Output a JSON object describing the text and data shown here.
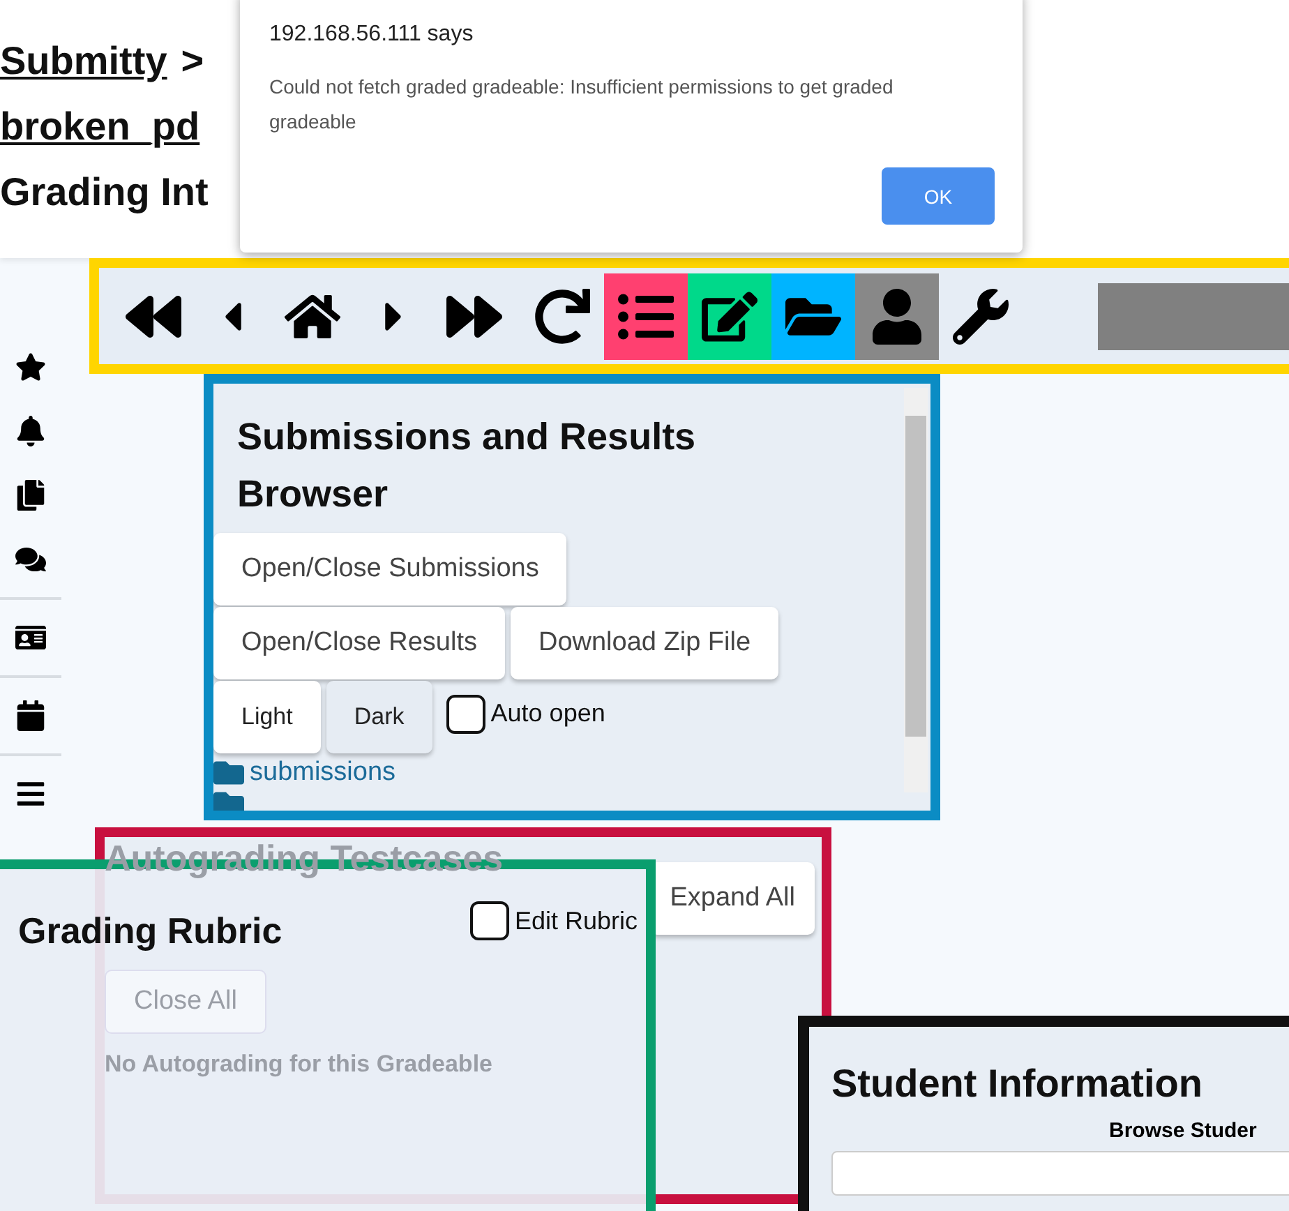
{
  "header": {
    "breadcrumb": [
      {
        "kind": "link",
        "text": "Submitty"
      },
      {
        "kind": "separator",
        "text": ">"
      },
      {
        "kind": "link",
        "text": "broken_pd"
      }
    ],
    "page_title": "Grading Int"
  },
  "dialog": {
    "origin": "192.168.56.111 says",
    "message": "Could not fetch graded gradeable: Insufficient permissions to get graded gradeable",
    "button": "OK"
  },
  "toolbar": {
    "buttons": [
      {
        "kind": "first"
      },
      {
        "kind": "prev"
      },
      {
        "kind": "home"
      },
      {
        "kind": "next"
      },
      {
        "kind": "last"
      },
      {
        "kind": "reload"
      },
      {
        "kind": "rubric",
        "color": "#ff4070"
      },
      {
        "kind": "notes",
        "color": "#00d98a"
      },
      {
        "kind": "files",
        "color": "#00b4ff"
      },
      {
        "kind": "student",
        "color": "#888888"
      },
      {
        "kind": "settings"
      }
    ]
  },
  "submissions_panel": {
    "title": "Submissions and Results Browser",
    "buttons": [
      "Open/Close Submissions",
      "Open/Close Results",
      "Download Zip File"
    ],
    "theme_buttons": [
      {
        "label": "Light",
        "selected": true
      },
      {
        "label": "Dark",
        "selected": false
      }
    ],
    "auto_open": {
      "label": "Auto open",
      "checked": false
    },
    "folders": [
      {
        "name": "submissions"
      }
    ]
  },
  "autograding_panel": {
    "title": "Autograding Testcases",
    "buttons": [
      "Expand All",
      "Close All"
    ],
    "message": "No Autograding for this Gradeable"
  },
  "rubric_panel": {
    "title": "Grading Rubric",
    "edit_rubric": {
      "label": "Edit Rubric",
      "checked": false
    }
  },
  "student_panel": {
    "title": "Student Information",
    "browse_label": "Browse Studer"
  }
}
